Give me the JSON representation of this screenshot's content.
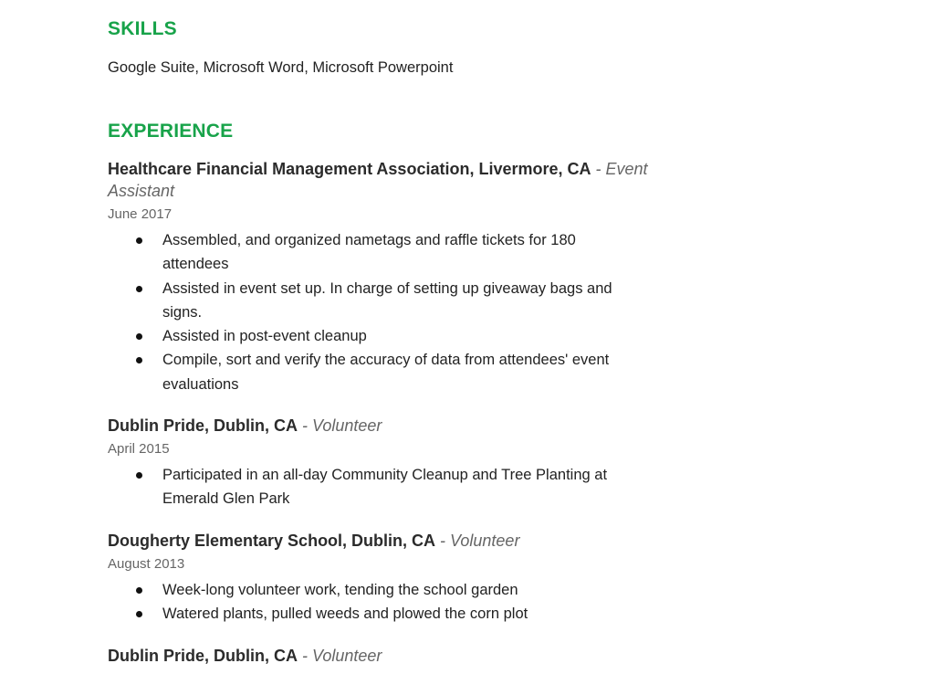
{
  "skills": {
    "heading": "SKILLS",
    "text": "Google Suite, Microsoft Word, Microsoft Powerpoint"
  },
  "experience": {
    "heading": "EXPERIENCE",
    "jobs": [
      {
        "org": "Healthcare Financial Management Association, Livermore, CA",
        "sep": " - ",
        "role": "Event Assistant",
        "date": "June 2017",
        "bullets": [
          "Assembled, and organized nametags and raffle tickets for 180 attendees",
          "Assisted in event set up.  In charge of setting up giveaway bags and signs.",
          "Assisted in post-event cleanup",
          "Compile, sort and verify the accuracy of data from attendees' event evaluations"
        ]
      },
      {
        "org": "Dublin Pride, Dublin, CA",
        "sep": " - ",
        "role": "Volunteer",
        "date": "April 2015",
        "bullets": [
          "Participated in an all-day Community Cleanup and Tree Planting at Emerald Glen Park"
        ]
      },
      {
        "org": "Dougherty Elementary School, Dublin, CA",
        "sep": " - ",
        "role": "Volunteer",
        "date": "August 2013",
        "bullets": [
          "Week-long volunteer work, tending the school garden",
          "Watered plants, pulled weeds and plowed the corn plot"
        ]
      },
      {
        "org": "Dublin Pride, Dublin, CA",
        "sep": " - ",
        "role": "Volunteer"
      }
    ]
  }
}
